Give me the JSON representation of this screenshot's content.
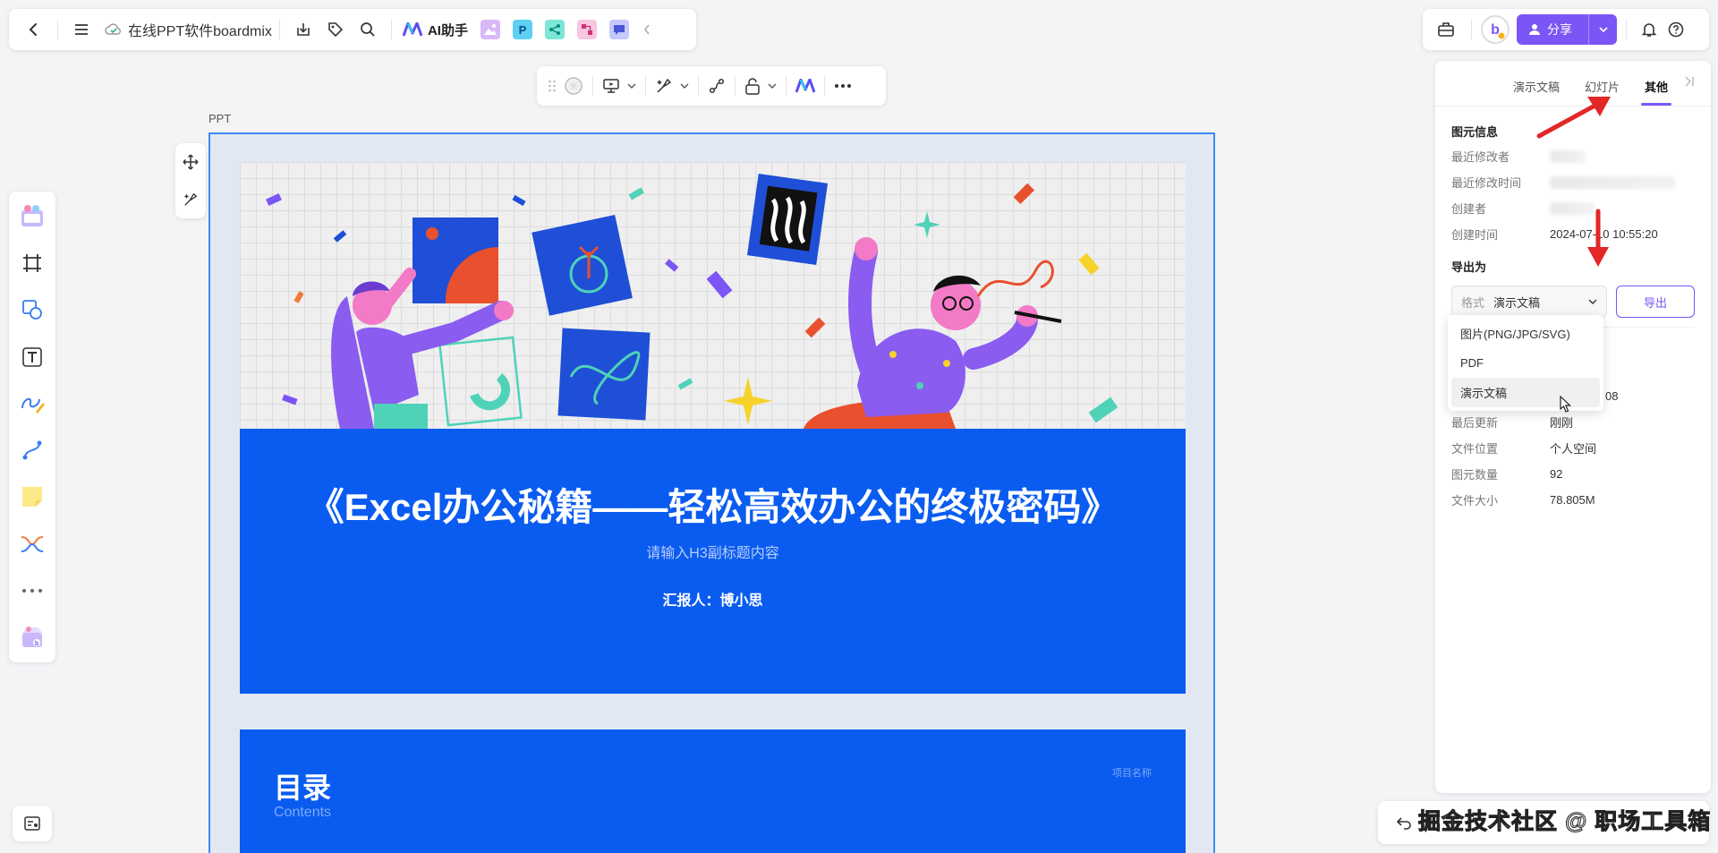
{
  "topbar": {
    "doc_title": "在线PPT软件boardmix",
    "ai_label": "AI助手",
    "p_label": "P"
  },
  "topright": {
    "share_label": "分享"
  },
  "canvas": {
    "frame_label": "PPT",
    "slide1": {
      "title": "《Excel办公秘籍——轻松高效办公的终极密码》",
      "subtitle": "请输入H3副标题内容",
      "reporter": "汇报人：博小思"
    },
    "slide2": {
      "title": "目录",
      "subtitle": "Contents",
      "project": "项目名称"
    }
  },
  "panel": {
    "tabs": [
      "演示文稿",
      "幻灯片",
      "其他"
    ],
    "active_tab": "其他",
    "element_info_title": "图元信息",
    "info": {
      "last_modifier_label": "最近修改者",
      "last_modified_time_label": "最近修改时间",
      "creator_label": "创建者",
      "created_time_label": "创建时间",
      "created_time_value": "2024-07-10 10:55:20"
    },
    "export_title": "导出为",
    "format_label": "格式",
    "format_value": "演示文稿",
    "export_button": "导出",
    "dropdown_options": [
      "图片(PNG/JPG/SVG)",
      "PDF",
      "演示文稿"
    ],
    "hovered_option": "演示文稿",
    "file_info": {
      "partial_value": "08",
      "last_update_label": "最后更新",
      "last_update_value": "刚刚",
      "location_label": "文件位置",
      "location_value": "个人空间",
      "element_count_label": "图元数量",
      "element_count_value": "92",
      "file_size_label": "文件大小",
      "file_size_value": "78.805M"
    }
  },
  "watermark": "掘金技术社区 @ 职场工具箱",
  "colors": {
    "accent": "#7b55f5",
    "slide_blue": "#0a5cf0",
    "frame_border": "#3d8bf5",
    "annotation_red": "#e32626"
  }
}
